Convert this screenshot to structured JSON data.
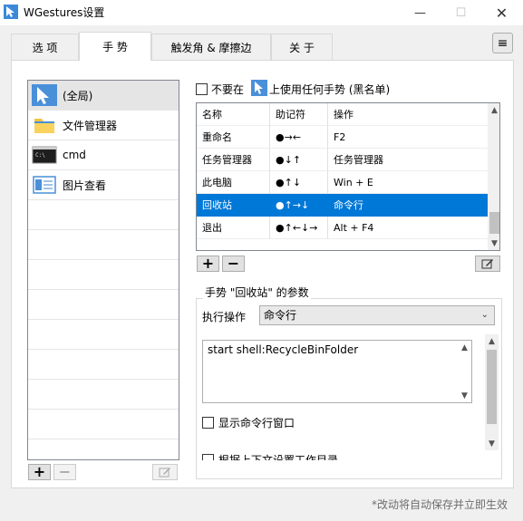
{
  "window": {
    "title": "WGestures设置",
    "minimize_icon": "minimize-icon",
    "maximize_icon": "maximize-icon",
    "close_icon": "close-icon"
  },
  "tabs": [
    {
      "label": "选 项",
      "active": false
    },
    {
      "label": "手 势",
      "active": true
    },
    {
      "label": "触发角 & 摩擦边",
      "active": false
    },
    {
      "label": "关 于",
      "active": false
    }
  ],
  "menu_icon": "hamburger-menu-icon",
  "apps": [
    {
      "label": "(全局)",
      "icon": "global-cursor-icon",
      "selected": true
    },
    {
      "label": "文件管理器",
      "icon": "folder-icon",
      "selected": false
    },
    {
      "label": "cmd",
      "icon": "cmd-icon",
      "selected": false
    },
    {
      "label": "图片查看",
      "icon": "image-viewer-icon",
      "selected": false
    }
  ],
  "app_buttons": {
    "add": "+",
    "remove": "−"
  },
  "blacklist": {
    "prefix": "不要在",
    "suffix": "上使用任何手势 (黑名单)",
    "checked": false
  },
  "gesture_table": {
    "headers": [
      "名称",
      "助记符",
      "操作"
    ],
    "rows": [
      {
        "name": "重命名",
        "symbol": "●→←",
        "action": "F2",
        "selected": false
      },
      {
        "name": "任务管理器",
        "symbol": "●↓↑",
        "action": "任务管理器",
        "selected": false
      },
      {
        "name": "此电脑",
        "symbol": "●↑↓",
        "action": "Win + E",
        "selected": false
      },
      {
        "name": "回收站",
        "symbol": "●↑→↓",
        "action": "命令行",
        "selected": true
      },
      {
        "name": "退出",
        "symbol": "●↑←↓→",
        "action": "Alt + F4",
        "selected": false
      }
    ]
  },
  "gesture_buttons": {
    "add": "+",
    "remove": "−"
  },
  "params": {
    "title": "手势 \"回收站\" 的参数",
    "action_label": "执行操作",
    "action_value": "命令行",
    "command": "start shell:RecycleBinFolder",
    "show_window_label": "显示命令行窗口",
    "cwd_label": "根据上下文设置工作目录"
  },
  "footer": "*改动将自动保存并立即生效",
  "colors": {
    "selection": "#0078d7",
    "accent_icon": "#4a90d9"
  }
}
